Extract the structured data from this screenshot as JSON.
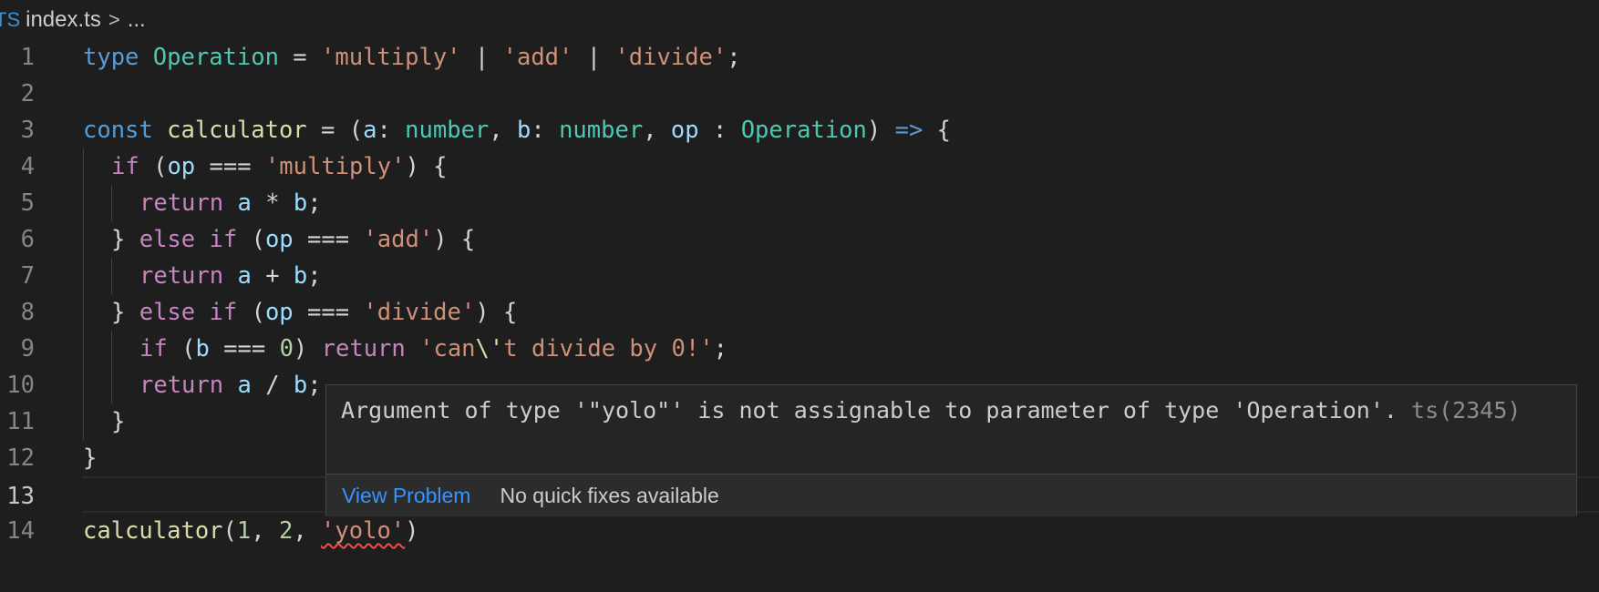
{
  "breadcrumb": {
    "file_icon": "TS",
    "file_icon_name": "typescript-file-icon",
    "file_name": "index.ts",
    "separator": ">",
    "ellipsis": "..."
  },
  "editor": {
    "current_line": 13,
    "lines": [
      {
        "number": "1",
        "tokens": [
          {
            "t": "type",
            "c": "kw-blue"
          },
          {
            "t": " "
          },
          {
            "t": "Operation",
            "c": "type"
          },
          {
            "t": " = ",
            "c": "op"
          },
          {
            "t": "'multiply'",
            "c": "str"
          },
          {
            "t": " | ",
            "c": "op"
          },
          {
            "t": "'add'",
            "c": "str"
          },
          {
            "t": " | ",
            "c": "op"
          },
          {
            "t": "'divide'",
            "c": "str"
          },
          {
            "t": ";",
            "c": "op"
          }
        ]
      },
      {
        "number": "2",
        "tokens": []
      },
      {
        "number": "3",
        "tokens": [
          {
            "t": "const",
            "c": "kw-blue"
          },
          {
            "t": " "
          },
          {
            "t": "calculator",
            "c": "fn"
          },
          {
            "t": " = (",
            "c": "op"
          },
          {
            "t": "a",
            "c": "var"
          },
          {
            "t": ": ",
            "c": "op"
          },
          {
            "t": "number",
            "c": "type"
          },
          {
            "t": ", ",
            "c": "op"
          },
          {
            "t": "b",
            "c": "var"
          },
          {
            "t": ": ",
            "c": "op"
          },
          {
            "t": "number",
            "c": "type"
          },
          {
            "t": ", ",
            "c": "op"
          },
          {
            "t": "op",
            "c": "var"
          },
          {
            "t": " : ",
            "c": "op"
          },
          {
            "t": "Operation",
            "c": "type"
          },
          {
            "t": ") ",
            "c": "op"
          },
          {
            "t": "=>",
            "c": "kw-blue"
          },
          {
            "t": " {",
            "c": "op"
          }
        ]
      },
      {
        "number": "4",
        "indent": 1,
        "tokens": [
          {
            "t": "if",
            "c": "kw-purple"
          },
          {
            "t": " (",
            "c": "op"
          },
          {
            "t": "op",
            "c": "var"
          },
          {
            "t": " === ",
            "c": "op"
          },
          {
            "t": "'multiply'",
            "c": "str"
          },
          {
            "t": ") {",
            "c": "op"
          }
        ]
      },
      {
        "number": "5",
        "indent": 2,
        "tokens": [
          {
            "t": "return",
            "c": "kw-purple"
          },
          {
            "t": " "
          },
          {
            "t": "a",
            "c": "var"
          },
          {
            "t": " * ",
            "c": "op"
          },
          {
            "t": "b",
            "c": "var"
          },
          {
            "t": ";",
            "c": "op"
          }
        ]
      },
      {
        "number": "6",
        "indent": 1,
        "tokens": [
          {
            "t": "} ",
            "c": "op"
          },
          {
            "t": "else",
            "c": "kw-purple"
          },
          {
            "t": " "
          },
          {
            "t": "if",
            "c": "kw-purple"
          },
          {
            "t": " (",
            "c": "op"
          },
          {
            "t": "op",
            "c": "var"
          },
          {
            "t": " === ",
            "c": "op"
          },
          {
            "t": "'add'",
            "c": "str"
          },
          {
            "t": ") {",
            "c": "op"
          }
        ]
      },
      {
        "number": "7",
        "indent": 2,
        "tokens": [
          {
            "t": "return",
            "c": "kw-purple"
          },
          {
            "t": " "
          },
          {
            "t": "a",
            "c": "var"
          },
          {
            "t": " + ",
            "c": "op"
          },
          {
            "t": "b",
            "c": "var"
          },
          {
            "t": ";",
            "c": "op"
          }
        ]
      },
      {
        "number": "8",
        "indent": 1,
        "tokens": [
          {
            "t": "} ",
            "c": "op"
          },
          {
            "t": "else",
            "c": "kw-purple"
          },
          {
            "t": " "
          },
          {
            "t": "if",
            "c": "kw-purple"
          },
          {
            "t": " (",
            "c": "op"
          },
          {
            "t": "op",
            "c": "var"
          },
          {
            "t": " === ",
            "c": "op"
          },
          {
            "t": "'divide'",
            "c": "str"
          },
          {
            "t": ") {",
            "c": "op"
          }
        ]
      },
      {
        "number": "9",
        "indent": 2,
        "tokens": [
          {
            "t": "if",
            "c": "kw-purple"
          },
          {
            "t": " (",
            "c": "op"
          },
          {
            "t": "b",
            "c": "var"
          },
          {
            "t": " === ",
            "c": "op"
          },
          {
            "t": "0",
            "c": "num"
          },
          {
            "t": ") ",
            "c": "op"
          },
          {
            "t": "return",
            "c": "kw-purple"
          },
          {
            "t": " "
          },
          {
            "t": "'can",
            "c": "str"
          },
          {
            "t": "\\'",
            "c": "fn"
          },
          {
            "t": "t divide by 0!'",
            "c": "str"
          },
          {
            "t": ";",
            "c": "op"
          }
        ]
      },
      {
        "number": "10",
        "indent": 2,
        "tokens": [
          {
            "t": "return",
            "c": "kw-purple"
          },
          {
            "t": " "
          },
          {
            "t": "a",
            "c": "var"
          },
          {
            "t": " / ",
            "c": "op"
          },
          {
            "t": "b",
            "c": "var"
          },
          {
            "t": ";",
            "c": "op"
          }
        ]
      },
      {
        "number": "11",
        "indent": 1,
        "tokens": [
          {
            "t": "}",
            "c": "op"
          }
        ]
      },
      {
        "number": "12",
        "tokens": [
          {
            "t": "}",
            "c": "op"
          }
        ]
      },
      {
        "number": "13",
        "tokens": []
      },
      {
        "number": "14",
        "tokens": [
          {
            "t": "calculator",
            "c": "fn"
          },
          {
            "t": "(",
            "c": "op"
          },
          {
            "t": "1",
            "c": "num"
          },
          {
            "t": ", ",
            "c": "op"
          },
          {
            "t": "2",
            "c": "num"
          },
          {
            "t": ", ",
            "c": "op"
          },
          {
            "t": "'yolo'",
            "c": "str",
            "error": true
          },
          {
            "t": ")",
            "c": "op"
          }
        ]
      }
    ]
  },
  "hover": {
    "message": "Argument of type '\"yolo\"' is not assignable to parameter of type 'Operation'.",
    "code": "ts(2345)",
    "view_problem_label": "View Problem",
    "no_fixes_label": "No quick fixes available"
  },
  "colors": {
    "background": "#1e1e1e",
    "keyword_blue": "#569cd6",
    "keyword_purple": "#c586c0",
    "type": "#4ec9b0",
    "string": "#ce9178",
    "number": "#b5cea8",
    "variable": "#9cdcfe",
    "function": "#dcdcaa",
    "error_squiggle": "#f14c4c",
    "link": "#3794ff"
  }
}
